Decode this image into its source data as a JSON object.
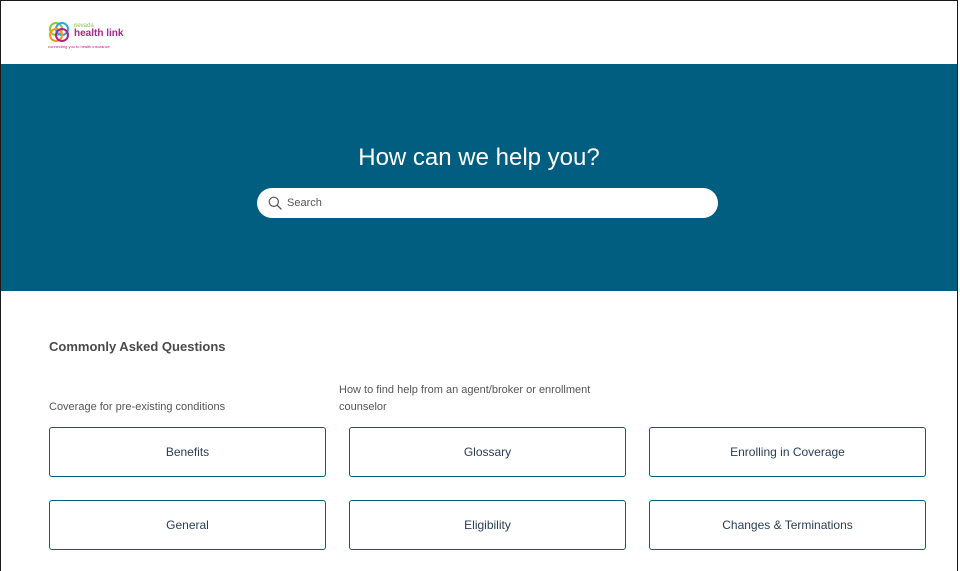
{
  "header": {
    "logo": {
      "state": "nevada",
      "brand": "health link",
      "tagline": "connecting you to health insurance"
    }
  },
  "hero": {
    "title": "How can we help you?",
    "search": {
      "placeholder": "Search",
      "value": ""
    }
  },
  "faq": {
    "heading": "Commonly Asked Questions",
    "links": [
      "Coverage for pre-existing conditions",
      "How to find help from an agent/broker or enrollment counselor"
    ]
  },
  "topics": [
    "Benefits",
    "Glossary",
    "Enrolling in Coverage",
    "General",
    "Eligibility",
    "Changes & Terminations"
  ],
  "colors": {
    "hero_bg": "#015e80",
    "button_border": "#015e80",
    "brand_magenta": "#b0238f",
    "brand_green": "#8dc63f"
  }
}
